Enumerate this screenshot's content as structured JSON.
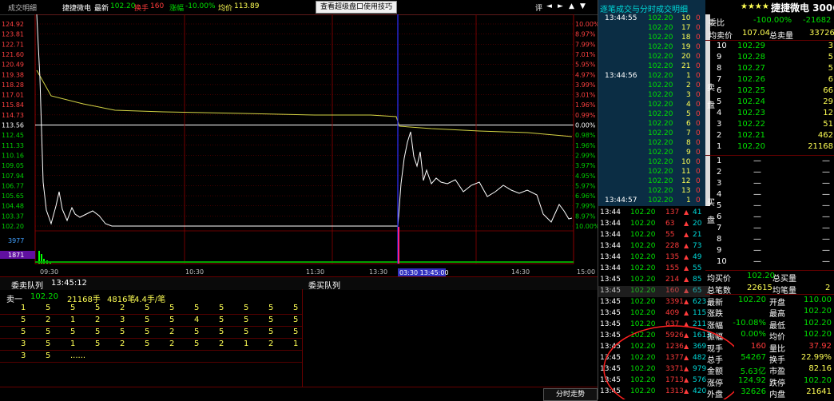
{
  "top_bar": {
    "title": "成交明细",
    "stock_name": "捷捷微电",
    "latest_label": "最新",
    "latest_value": "102.20",
    "change_label": "换手",
    "change_value": "160",
    "pct_label": "涨幅",
    "pct_value": "-10.00%",
    "avg_label": "均价",
    "avg_value": "113.89",
    "tip_button": "查看超级盘口使用技巧",
    "ctrl_labels": [
      "评",
      "◄",
      "►",
      "▲",
      "▼"
    ]
  },
  "chart": {
    "price_ticks": [
      "124.92",
      "123.81",
      "122.71",
      "121.60",
      "120.49",
      "119.38",
      "118.28",
      "117.01",
      "115.84",
      "114.73",
      "113.56",
      "112.45",
      "111.33",
      "110.16",
      "109.05",
      "107.94",
      "106.77",
      "105.65",
      "104.48",
      "103.37",
      "102.20"
    ],
    "pct_ticks": [
      "10.00%",
      "8.97%",
      "7.99%",
      "7.01%",
      "5.95%",
      "4.97%",
      "3.99%",
      "3.01%",
      "1.96%",
      "0.99%",
      "0.00%",
      "0.98%",
      "1.96%",
      "2.99%",
      "3.97%",
      "4.95%",
      "5.97%",
      "6.96%",
      "7.99%",
      "8.97%",
      "10.00%"
    ],
    "volume_ticks": [
      "3977",
      "1871"
    ],
    "time_ticks": [
      "09:30",
      "10:30",
      "11:30",
      "13:30",
      "14:30",
      "15:00"
    ],
    "cursor_label": "03:30 13:45:00",
    "colors": {
      "grid": "#8b0000",
      "price": "#ffffff",
      "avg": "#d4d444",
      "volume": "#00ff00",
      "cursor": "#3030ff",
      "base": "#ffffff"
    }
  },
  "queue": {
    "left_title": "委卖队列",
    "time": "13:45:12",
    "right_title": "委买队列",
    "sell1_label": "卖一",
    "sell1_price": "102.20",
    "sell1_vol": "21168手",
    "sell1_count": "4816笔",
    "sell1_avg": "4.4手/笔",
    "rows": [
      [
        "1",
        "5",
        "5",
        "5",
        "2",
        "5",
        "5",
        "5",
        "5",
        "5",
        "5",
        "5"
      ],
      [
        "5",
        "2",
        "1",
        "2",
        "3",
        "5",
        "5",
        "4",
        "5",
        "5",
        "5",
        "5"
      ],
      [
        "5",
        "5",
        "5",
        "5",
        "5",
        "5",
        "2",
        "5",
        "5",
        "5",
        "5",
        "5"
      ],
      [
        "3",
        "5",
        "1",
        "5",
        "2",
        "5",
        "2",
        "5",
        "2",
        "1",
        "2",
        "1"
      ],
      [
        "3",
        "5",
        "......",
        "",
        "",
        "",
        "",
        "",
        "",
        "",
        "",
        ""
      ]
    ]
  },
  "bottom_tab": "分时走势",
  "right": {
    "detail_title": "逐笔成交与分时成交明细",
    "stock_title": "捷捷微电 300623",
    "stars": "★★★★",
    "ticks_detail": [
      {
        "t": "13:44:55",
        "p": "102.20",
        "v": "10"
      },
      {
        "t": "",
        "p": "102.20",
        "v": "17"
      },
      {
        "t": "",
        "p": "102.20",
        "v": "18"
      },
      {
        "t": "",
        "p": "102.20",
        "v": "19"
      },
      {
        "t": "",
        "p": "102.20",
        "v": "20"
      },
      {
        "t": "",
        "p": "102.20",
        "v": "21"
      },
      {
        "t": "13:44:56",
        "p": "102.20",
        "v": "1"
      },
      {
        "t": "",
        "p": "102.20",
        "v": "2"
      },
      {
        "t": "",
        "p": "102.20",
        "v": "3"
      },
      {
        "t": "",
        "p": "102.20",
        "v": "4"
      },
      {
        "t": "",
        "p": "102.20",
        "v": "5"
      },
      {
        "t": "",
        "p": "102.20",
        "v": "6"
      },
      {
        "t": "",
        "p": "102.20",
        "v": "7"
      },
      {
        "t": "",
        "p": "102.20",
        "v": "8"
      },
      {
        "t": "",
        "p": "102.20",
        "v": "9"
      },
      {
        "t": "",
        "p": "102.20",
        "v": "10"
      },
      {
        "t": "",
        "p": "102.20",
        "v": "11"
      },
      {
        "t": "",
        "p": "102.20",
        "v": "12"
      },
      {
        "t": "",
        "p": "102.20",
        "v": "13"
      },
      {
        "t": "13:44:57",
        "p": "102.20",
        "v": "1"
      }
    ],
    "ticks_detail_counts": [
      "0",
      "0",
      "0",
      "0",
      "0",
      "0",
      "0",
      "0",
      "0",
      "0",
      "0",
      "0",
      "0",
      "0",
      "0",
      "0",
      "0",
      "0",
      "0",
      "0"
    ],
    "ticks_min": [
      {
        "t": "13:44",
        "p": "102.20",
        "v": "137",
        "n": "41"
      },
      {
        "t": "13:44",
        "p": "102.20",
        "v": "63",
        "n": "20"
      },
      {
        "t": "13:44",
        "p": "102.20",
        "v": "55",
        "n": "21"
      },
      {
        "t": "13:44",
        "p": "102.20",
        "v": "228",
        "n": "73"
      },
      {
        "t": "13:44",
        "p": "102.20",
        "v": "135",
        "n": "49"
      },
      {
        "t": "13:44",
        "p": "102.20",
        "v": "155",
        "n": "55"
      },
      {
        "t": "13:45",
        "p": "102.20",
        "v": "214",
        "n": "85"
      },
      {
        "t": "13:45",
        "p": "102.20",
        "v": "160",
        "n": "65"
      },
      {
        "t": "13:45",
        "p": "102.20",
        "v": "3391",
        "n": "623"
      },
      {
        "t": "13:45",
        "p": "102.20",
        "v": "409",
        "n": "115"
      },
      {
        "t": "13:45",
        "p": "102.20",
        "v": "637",
        "n": "211"
      },
      {
        "t": "13:45",
        "p": "102.20",
        "v": "5926",
        "n": "1613"
      },
      {
        "t": "13:45",
        "p": "102.20",
        "v": "1236",
        "n": "369"
      },
      {
        "t": "13:45",
        "p": "102.20",
        "v": "1377",
        "n": "482"
      },
      {
        "t": "13:45",
        "p": "102.20",
        "v": "3371",
        "n": "979"
      },
      {
        "t": "13:45",
        "p": "102.20",
        "v": "1713",
        "n": "576"
      },
      {
        "t": "13:45",
        "p": "102.20",
        "v": "1313",
        "n": "420"
      }
    ],
    "order_stats": {
      "weibi_label": "委比",
      "weibi_value": "-100.00%",
      "weibi_diff": "-21682",
      "avg_sell_label": "均卖价",
      "avg_sell_value": "107.04",
      "total_sell_label": "总卖量",
      "total_sell_value": "33726"
    },
    "sell_levels": [
      {
        "n": "10",
        "p": "102.29",
        "v": "3"
      },
      {
        "n": "9",
        "p": "102.28",
        "v": "5"
      },
      {
        "n": "8",
        "p": "102.27",
        "v": "5"
      },
      {
        "n": "7",
        "p": "102.26",
        "v": "6"
      },
      {
        "n": "6",
        "p": "102.25",
        "v": "66"
      },
      {
        "n": "5",
        "p": "102.24",
        "v": "29"
      },
      {
        "n": "4",
        "p": "102.23",
        "v": "12"
      },
      {
        "n": "3",
        "p": "102.22",
        "v": "51"
      },
      {
        "n": "2",
        "p": "102.21",
        "v": "462"
      },
      {
        "n": "1",
        "p": "102.20",
        "v": "21168"
      }
    ],
    "sell_side_label": "卖盘",
    "buy_side_label": "买盘",
    "buy_levels": [
      "1",
      "2",
      "3",
      "4",
      "5",
      "6",
      "7",
      "8",
      "9",
      "10"
    ],
    "dash": "—",
    "buy_stats": {
      "avg_buy_label": "均买价",
      "avg_buy_value": "102.20",
      "total_buy_label": "总买量",
      "total_buy_value": "",
      "total_count_label": "总笔数",
      "total_count_value": "22615",
      "avg_count_label": "均笔量",
      "avg_count_value": "2"
    },
    "quote": [
      {
        "a": "最新",
        "av": "102.20",
        "b": "开盘",
        "bv": "110.00"
      },
      {
        "a": "涨跌",
        "av": "",
        "b": "最高",
        "bv": "102.20"
      },
      {
        "a": "涨幅",
        "av": "-10.08%",
        "b": "最低",
        "bv": "102.20"
      },
      {
        "a": "振幅",
        "av": "0.00%",
        "b": "均价",
        "bv": "102.20"
      },
      {
        "a": "现手",
        "av": "160",
        "b": "量比",
        "bv": "37.92"
      },
      {
        "a": "总手",
        "av": "54267",
        "b": "换手",
        "bv": "22.99%"
      },
      {
        "a": "金额",
        "av": "5.63亿",
        "b": "市盈",
        "bv": "82.16"
      },
      {
        "a": "涨停",
        "av": "124.92",
        "b": "跌停",
        "bv": "102.20"
      },
      {
        "a": "外盘",
        "av": "32626",
        "b": "内盘",
        "bv": "21641"
      }
    ]
  }
}
